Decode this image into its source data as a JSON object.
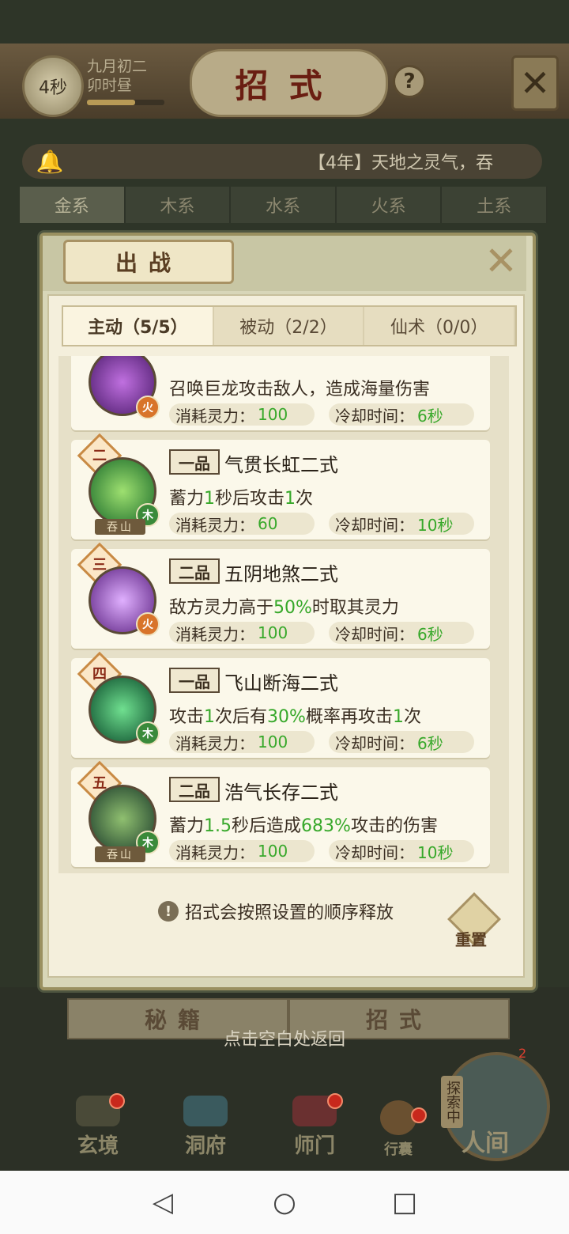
{
  "top": {
    "countdown": "4秒",
    "date_line1": "九月初二",
    "date_line2": "卯时昼",
    "date_progress": 0.62,
    "title": "招式",
    "help": "?",
    "close": "✕"
  },
  "news": {
    "text": "【4年】天地之灵气，吞"
  },
  "element_tabs": [
    "金系",
    "木系",
    "水系",
    "火系",
    "土系"
  ],
  "dialog": {
    "title": "出战",
    "close": "✕",
    "tabs": [
      "主动（5/5）",
      "被动（2/2）",
      "仙术（0/0）"
    ],
    "cost_label": "消耗灵力：",
    "cd_label": "冷却时间：",
    "skills": [
      {
        "rank": "",
        "grade": "",
        "name": "",
        "element": "火",
        "sect": "",
        "desc": [
          "召唤巨龙攻击敌人，造成海量伤害"
        ],
        "cost": "100",
        "cooldown": "6秒"
      },
      {
        "rank": "二",
        "grade": "一品",
        "name": "气贯长虹二式",
        "element": "木",
        "sect": "吞山",
        "desc": [
          "蓄力",
          "1",
          "秒后攻击",
          "1",
          "次"
        ],
        "cost": "60",
        "cooldown": "10秒"
      },
      {
        "rank": "三",
        "grade": "二品",
        "name": "五阴地煞二式",
        "element": "火",
        "sect": "",
        "desc": [
          "敌方灵力高于",
          "50%",
          "时取其灵力"
        ],
        "cost": "100",
        "cooldown": "6秒"
      },
      {
        "rank": "四",
        "grade": "一品",
        "name": "飞山断海二式",
        "element": "木",
        "sect": "",
        "desc": [
          "攻击",
          "1",
          "次后有",
          "30%",
          "概率再攻击",
          "1",
          "次"
        ],
        "cost": "100",
        "cooldown": "6秒"
      },
      {
        "rank": "五",
        "grade": "二品",
        "name": "浩气长存二式",
        "element": "木",
        "sect": "吞山",
        "desc": [
          "蓄力",
          "1.5",
          "秒后造成",
          "683%",
          "攻击的伤害"
        ],
        "cost": "100",
        "cooldown": "10秒"
      }
    ],
    "order_tip": "招式会按照设置的顺序释放",
    "reset": "重置"
  },
  "bottom": {
    "tabs": [
      "秘籍",
      "招式"
    ],
    "hint": "点击空白处返回",
    "nav": [
      "玄境",
      "洞府",
      "师门",
      "行囊"
    ],
    "explore_tag": "探索中",
    "explore_count": "2",
    "explore_label": "人间"
  },
  "system_nav": {
    "back": "◁",
    "home": "○",
    "recent": "□"
  },
  "colors": {
    "highlight_green": "#37a82a",
    "fire": "#d8742a",
    "wood": "#3a8a3a"
  }
}
